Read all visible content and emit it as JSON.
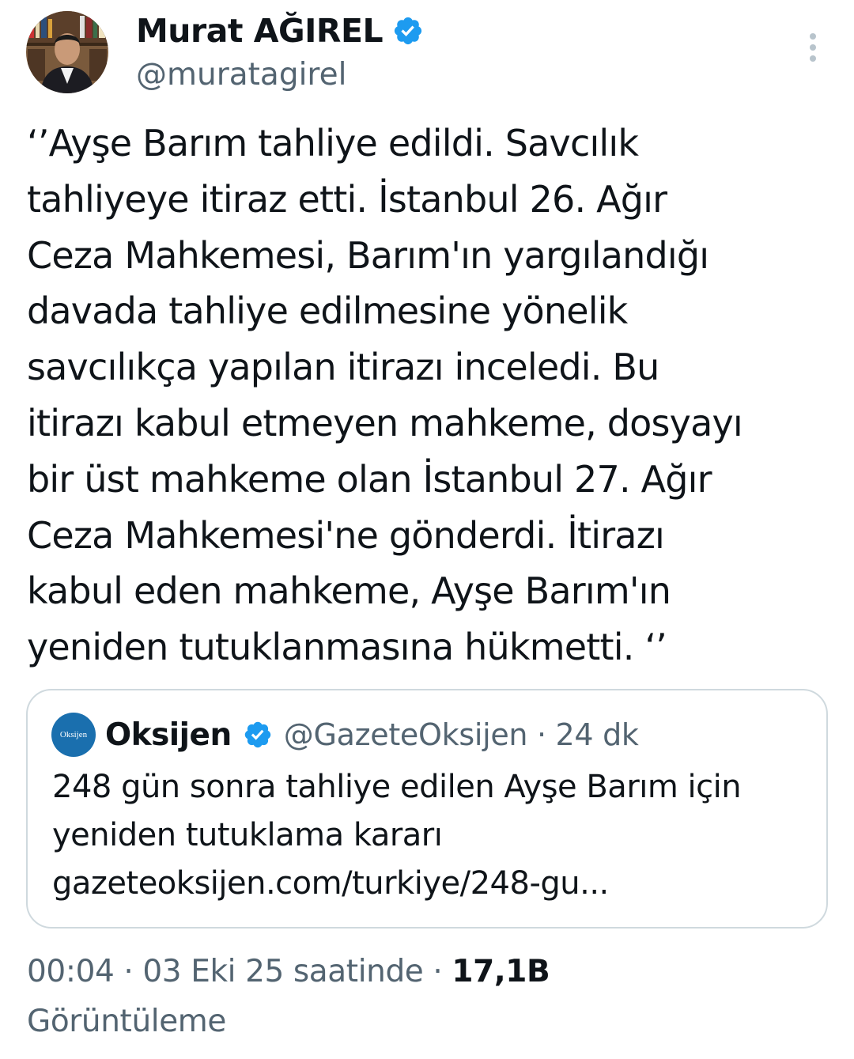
{
  "author": {
    "display_name": "Murat AĞIREL",
    "handle": "@muratagirel",
    "verified": true,
    "avatar_icon": "profile-photo"
  },
  "tweet": {
    "lines": [
      "‘’Ayşe Barım tahliye edildi. Savcılık",
      "tahliyeye itiraz etti. İstanbul 26. Ağır",
      "Ceza Mahkemesi, Barım'ın yargılandığı",
      "davada tahliye edilmesine yönelik",
      "savcılıkça yapılan itirazı inceledi. Bu",
      "itirazı kabul etmeyen mahkeme, dosyayı",
      "bir üst mahkeme olan İstanbul 27. Ağır",
      "Ceza Mahkemesi'ne gönderdi. İtirazı",
      "kabul eden mahkeme, Ayşe Barım'ın",
      "yeniden tutuklanmasına hükmetti. ‘’"
    ]
  },
  "quote": {
    "avatar_text": "Oksijen",
    "display_name": "Oksijen",
    "verified": true,
    "meta": "@GazeteOksijen · 24 dk",
    "lines": [
      "248 gün sonra tahliye edilen Ayşe Barım için",
      "yeniden tutuklama kararı",
      "gazeteoksijen.com/turkiye/248-gu..."
    ]
  },
  "footer": {
    "timestamp": "00:04 · 03 Eki 25 saatinde · ",
    "views_count": "17,1B",
    "views_label": "Görüntüleme"
  },
  "colors": {
    "verified_blue": "#1d9bf0",
    "secondary_text": "#536471",
    "primary_text": "#0f1419",
    "border": "#cfd9de"
  }
}
